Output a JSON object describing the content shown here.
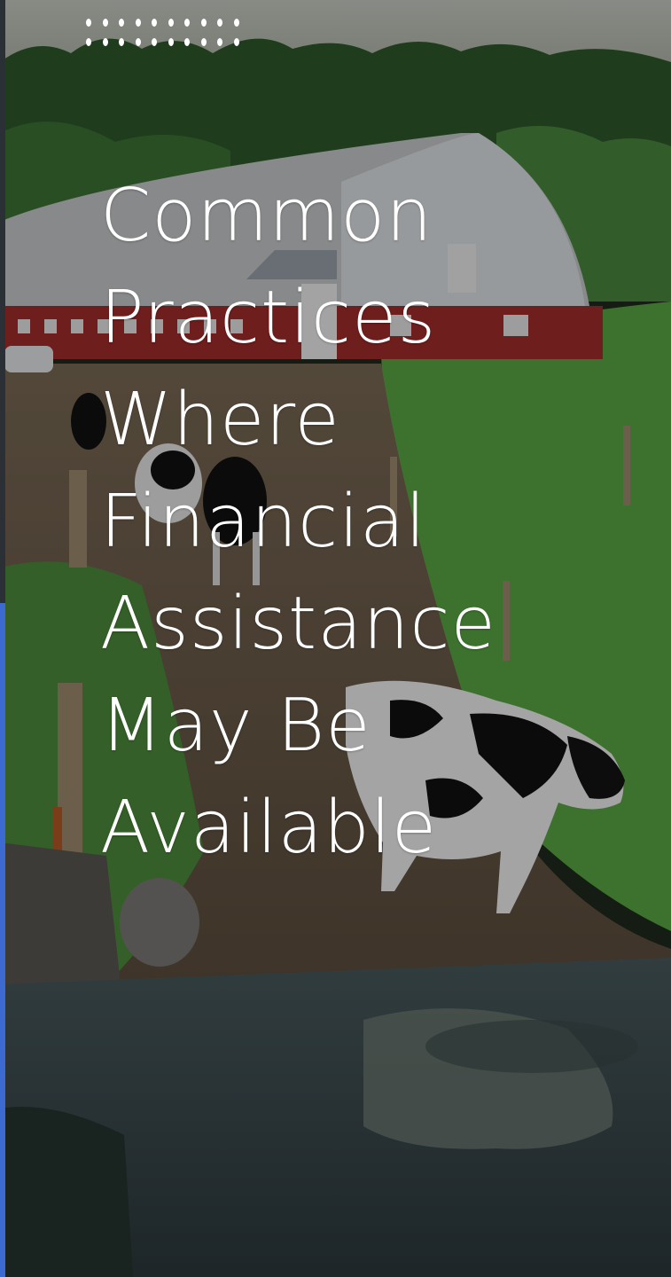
{
  "slide": {
    "title": "Common\nPractices\nWhere\nFinancial\nAssistance\nMay Be\nAvailable",
    "background_image": "photo-of-dairy-farm-with-barn-cows-and-puddle",
    "overlay_color": "#000000",
    "accent_color": "#3d6ad1",
    "decor_dots_rows": 2,
    "decor_dots_cols": 10
  }
}
